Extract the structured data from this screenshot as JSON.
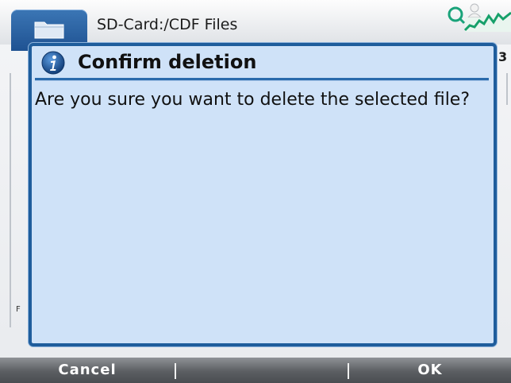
{
  "header": {
    "path": "SD-Card:/CDF Files",
    "side_char": "3",
    "side_char_left": "F"
  },
  "dialog": {
    "title": "Confirm deletion",
    "message": "Are you sure you want to delete the selected file?",
    "icon": "info-icon"
  },
  "softkeys": {
    "cancel": "Cancel",
    "middle": "",
    "ok": "OK"
  },
  "colors": {
    "dialog_bg": "#cfe2f8",
    "dialog_border": "#1f5d9c",
    "softkey_bar": "#5b5e62",
    "accent": "#2a6aac"
  }
}
